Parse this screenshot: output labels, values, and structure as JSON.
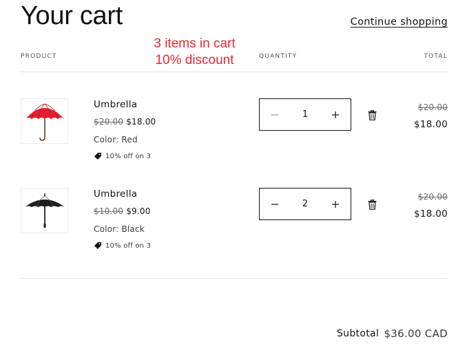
{
  "page": {
    "title": "Your cart",
    "continue_link": "Continue shopping"
  },
  "annotation": {
    "line1": "3 items in cart",
    "line2": "10% discount",
    "color": "#e8282e"
  },
  "columns": {
    "product": "PRODUCT",
    "quantity": "QUANTITY",
    "total": "TOTAL"
  },
  "items": [
    {
      "name": "Umbrella",
      "old_price": "$20.00",
      "price": "$18.00",
      "color": "Color: Red",
      "discount": "10% off on 3",
      "quantity": "1",
      "total_old": "$20.00",
      "total": "$18.00",
      "image_color": "#e51f33",
      "image_icon": "red-umbrella"
    },
    {
      "name": "Umbrella",
      "old_price": "$10.00",
      "price": "$9.00",
      "color": "Color: Black",
      "discount": "10% off on 3",
      "quantity": "2",
      "total_old": "$20.00",
      "total": "$18.00",
      "image_color": "#1e1e1e",
      "image_icon": "black-umbrella"
    }
  ],
  "summary": {
    "subtotal_label": "Subtotal",
    "subtotal_value": "$36.00 CAD"
  }
}
